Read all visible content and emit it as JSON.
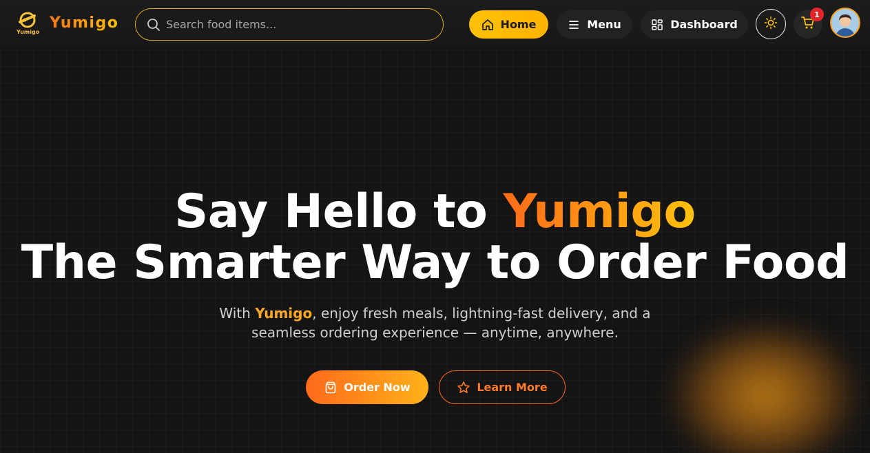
{
  "brand": {
    "name": "Yumigo",
    "mark_text": "Yumigo",
    "logo_icon": "scooter-logo-icon"
  },
  "search": {
    "placeholder": "Search food items...",
    "value": "",
    "icon": "search-icon"
  },
  "nav": {
    "home": {
      "label": "Home",
      "icon": "home-icon",
      "active": true
    },
    "menu": {
      "label": "Menu",
      "icon": "hamburger-icon"
    },
    "dashboard": {
      "label": "Dashboard",
      "icon": "grid-icon"
    },
    "theme_toggle_icon": "sun-icon",
    "cart_icon": "cart-icon",
    "cart_count": "1",
    "avatar_icon": "user-avatar"
  },
  "hero": {
    "title_part1": "Say Hello to ",
    "title_accent": "Yumigo",
    "title_line2": "The Smarter Way to Order Food",
    "subtitle_pre": "With ",
    "subtitle_brand": "Yumigo",
    "subtitle_post": ", enjoy fresh meals, lightning-fast delivery, and a",
    "subtitle_line2": "seamless ordering experience — anytime, anywhere."
  },
  "cta": {
    "order": {
      "label": "Order Now",
      "icon": "shopping-bag-icon"
    },
    "learn": {
      "label": "Learn More",
      "icon": "star-icon"
    }
  },
  "colors": {
    "background": "#141414",
    "accent_orange": "#ff6a1a",
    "accent_yellow": "#ffc107",
    "badge_red": "#e5252a"
  }
}
